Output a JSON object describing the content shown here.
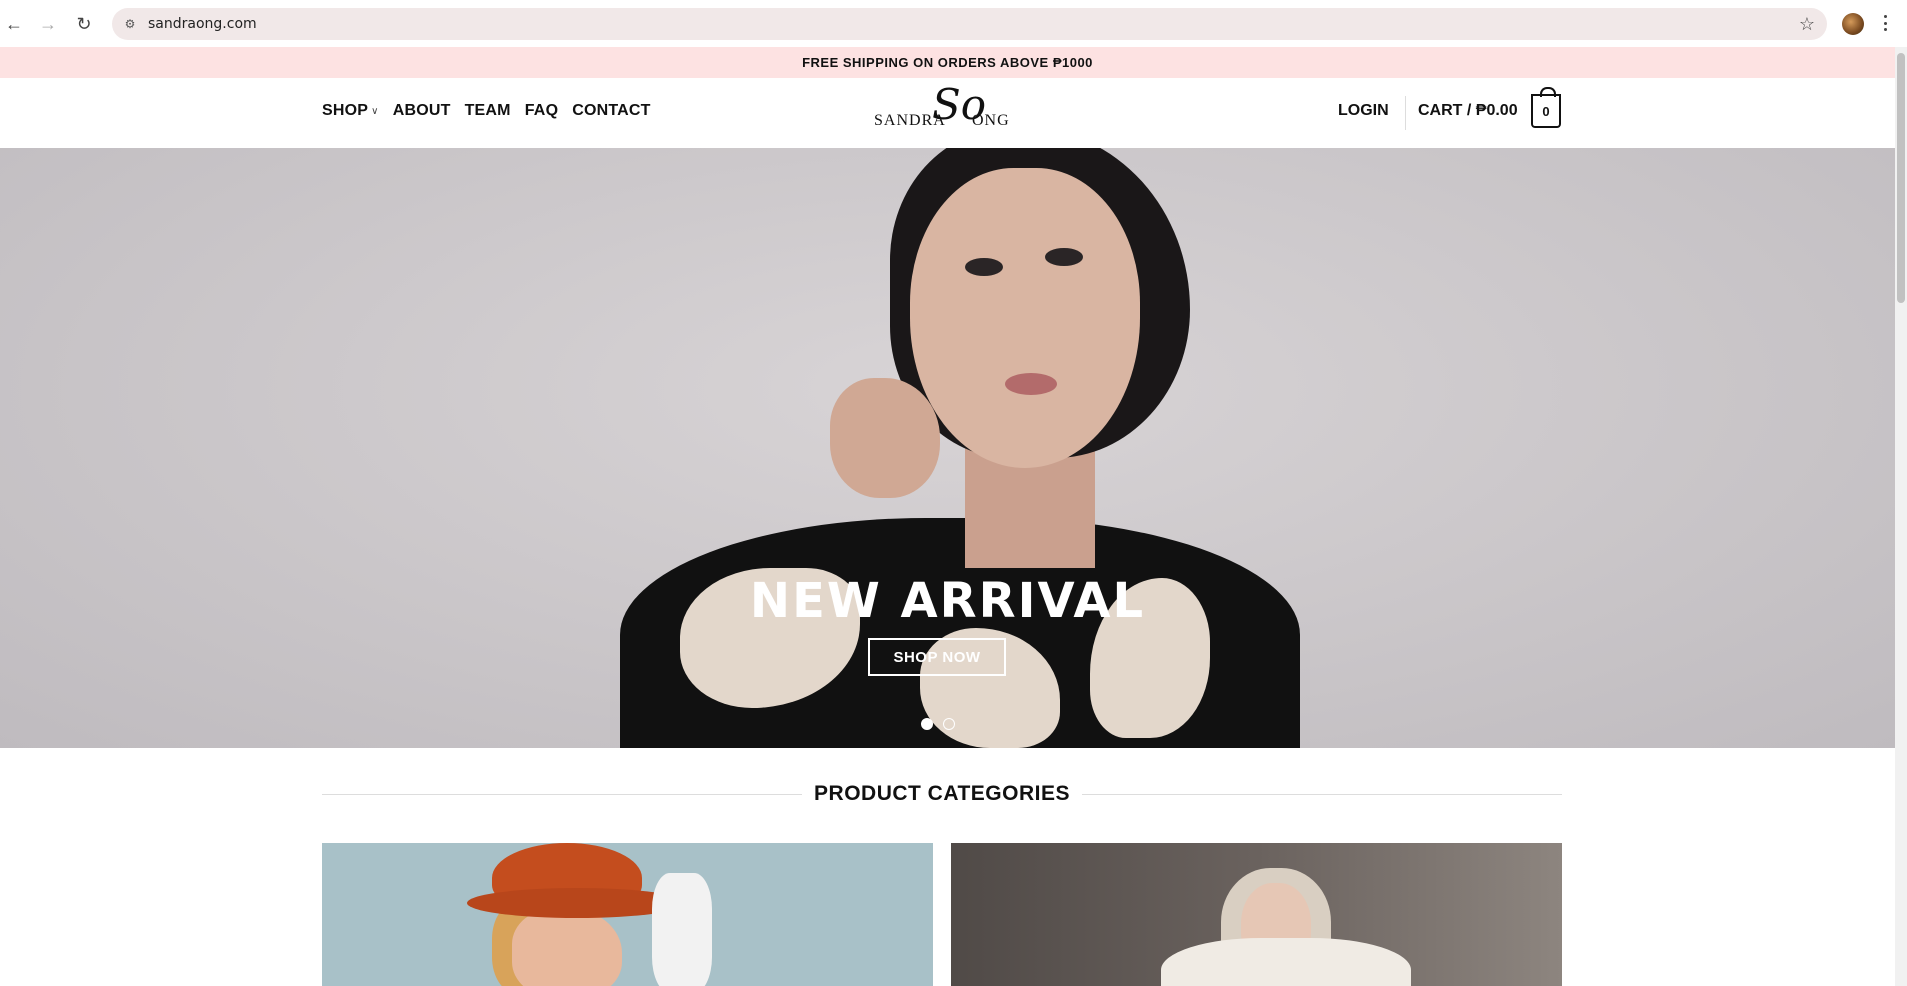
{
  "browser": {
    "url": "sandraong.com",
    "icons": [
      "back-icon",
      "forward-icon",
      "reload-icon",
      "site-settings-icon",
      "bookmark-star-icon",
      "profile-avatar",
      "menu-icon"
    ]
  },
  "announcement": "FREE SHIPPING ON ORDERS ABOVE ₱1000",
  "header": {
    "nav": [
      "SHOP",
      "ABOUT",
      "TEAM",
      "FAQ",
      "CONTACT"
    ],
    "logo": {
      "left": "SANDRA",
      "script": "So",
      "right": "ONG"
    },
    "login": "LOGIN",
    "cart_label": "CART / ₱0.00",
    "cart_count": "0"
  },
  "hero": {
    "title": "NEW ARRIVAL",
    "button": "SHOP NOW",
    "slides": 2,
    "active_slide": 1
  },
  "categories": {
    "title": "PRODUCT CATEGORIES"
  }
}
